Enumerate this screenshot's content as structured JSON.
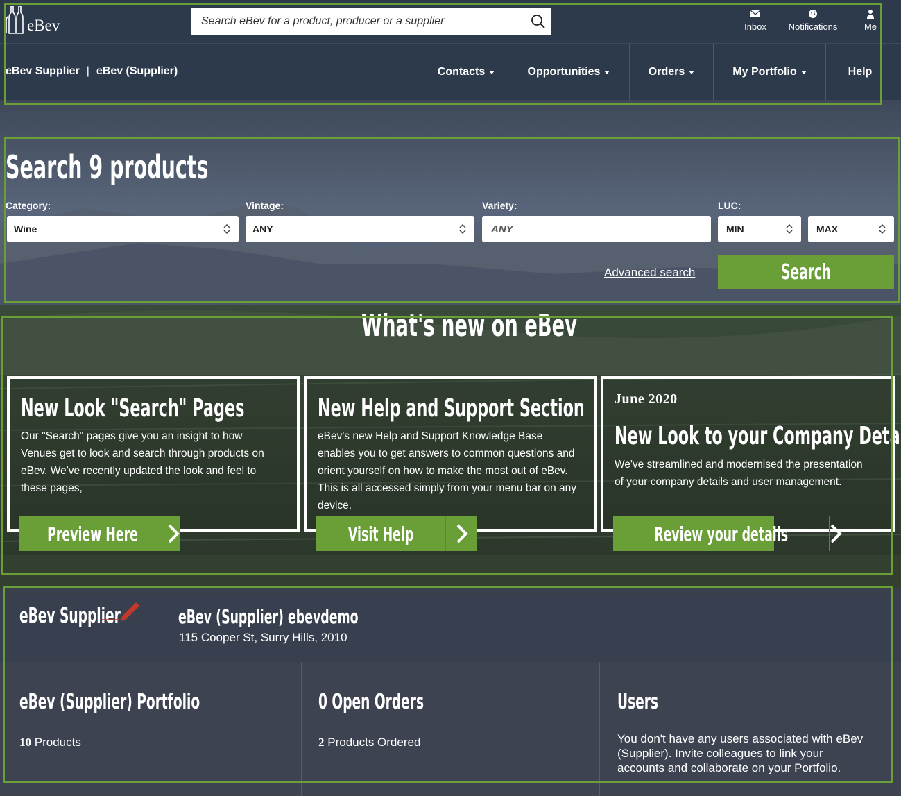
{
  "header": {
    "logo_text": "eBev",
    "search_placeholder": "Search eBev for a product, producer or a supplier",
    "icons": [
      {
        "label": "Inbox",
        "icon": "envelope-icon"
      },
      {
        "label": "Notifications",
        "icon": "globe-icon"
      },
      {
        "label": "Me",
        "icon": "user-icon"
      }
    ]
  },
  "nav": {
    "company_name": "eBev Supplier",
    "separator": "|",
    "company_type": "eBev (Supplier)",
    "items": [
      {
        "label": "Contacts",
        "dropdown": true
      },
      {
        "label": "Opportunities",
        "dropdown": true
      },
      {
        "label": "Orders",
        "dropdown": true
      },
      {
        "label": "My Portfolio",
        "dropdown": true
      },
      {
        "label": "Help",
        "dropdown": false
      }
    ]
  },
  "search_panel": {
    "title": "Search 9 products",
    "category_label": "Category:",
    "category_value": "Wine",
    "vintage_label": "Vintage:",
    "vintage_value": "ANY",
    "variety_label": "Variety:",
    "variety_placeholder": "ANY",
    "luc_label": "LUC:",
    "luc_min": "MIN",
    "luc_max": "MAX",
    "advanced_link": "Advanced search",
    "search_button": "Search"
  },
  "whats_new": {
    "title": "What's new on eBev",
    "cards": [
      {
        "date": "",
        "title": "New Look \"Search\" Pages",
        "body": [
          "Our \"Search\" pages give you an insight to how",
          "Venues get to look and search through products on",
          "eBev. We've recently updated the look and feel to",
          "these pages,"
        ],
        "button": "Preview Here"
      },
      {
        "date": "",
        "title": "New Help and Support Section",
        "body": [
          "eBev's new Help and Support Knowledge Base",
          "enables you to get answers to common questions and",
          "orient yourself on how to make the most out of eBev.",
          "This is all accessed simply from your menu bar on any",
          "device."
        ],
        "button": "Visit Help"
      },
      {
        "date": "June 2020",
        "title": "New Look to your Company Details",
        "body": [
          "We've streamlined and modernised the presentation",
          "of your company details and user management."
        ],
        "button": "Review your details"
      }
    ]
  },
  "profile": {
    "name": "eBev Supplier",
    "edit_icon": "pencil-icon",
    "company": "eBev (Supplier) ebevdemo",
    "address": "115 Cooper St, Surry Hills, 2010"
  },
  "dashboard": {
    "portfolio_title": "eBev (Supplier) Portfolio",
    "products_count": "10",
    "products_link": "Products",
    "orders_title": "0 Open Orders",
    "ordered_count": "2",
    "ordered_link": "Products Ordered",
    "users_title": "Users",
    "users_text": [
      "You don't have any users associated with eBev",
      "(Supplier). Invite colleagues to link your",
      "accounts and collaborate on your Portfolio."
    ]
  }
}
